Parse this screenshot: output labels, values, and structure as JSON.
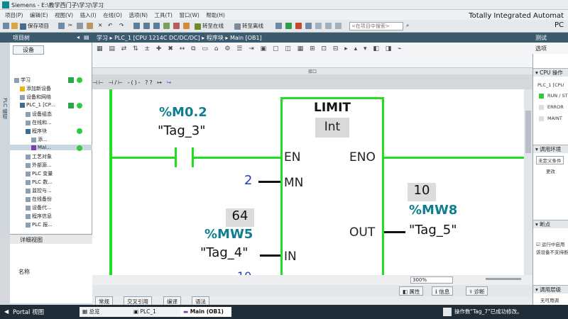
{
  "window": {
    "title": "Siemens - E:\\教学西门子\\学习\\学习",
    "brand_line1": "Totally Integrated Automat",
    "brand_line2": "PC"
  },
  "menu": [
    "项目(P)",
    "编辑(E)",
    "视图(V)",
    "插入(I)",
    "在线(O)",
    "选项(N)",
    "工具(T)",
    "窗口(W)",
    "帮助(H)"
  ],
  "toolbar": {
    "save_label": "保存项目",
    "go_online": "转至在线",
    "go_offline": "转至离线",
    "search_placeholder": "<在项目中搜索>"
  },
  "project_tree": {
    "header": "项目树",
    "tab": "设备",
    "side_label": "PLC 编程",
    "items": [
      {
        "label": "学习",
        "indent": 0
      },
      {
        "label": "添加新设备",
        "indent": 1
      },
      {
        "label": "设备和网络",
        "indent": 1
      },
      {
        "label": "PLC_1 [CP...",
        "indent": 1
      },
      {
        "label": "设备组态",
        "indent": 2
      },
      {
        "label": "在线和...",
        "indent": 2
      },
      {
        "label": "程序块",
        "indent": 2
      },
      {
        "label": "添...",
        "indent": 3
      },
      {
        "label": "Mai...",
        "indent": 3
      },
      {
        "label": "工艺对象",
        "indent": 2
      },
      {
        "label": "外部源...",
        "indent": 2
      },
      {
        "label": "PLC 变量",
        "indent": 2
      },
      {
        "label": "PLC 数...",
        "indent": 2
      },
      {
        "label": "监控与...",
        "indent": 2
      },
      {
        "label": "在线备份",
        "indent": 2
      },
      {
        "label": "设备代...",
        "indent": 2
      },
      {
        "label": "程序信息",
        "indent": 2
      },
      {
        "label": "PLC 报...",
        "indent": 2
      }
    ]
  },
  "detail_view": {
    "header": "详细视图",
    "column": "名称"
  },
  "breadcrumb": "学习 ▸ PLC_1 [CPU 1214C DC/DC/DC] ▸ 程序块 ▸ Main [OB1]",
  "editor": {
    "interface_label": "接口",
    "zoom": "300%",
    "block": {
      "name": "LIMIT",
      "type": "Int",
      "pin_en": "EN",
      "pin_eno": "ENO",
      "pin_mn": "MN",
      "pin_in": "IN",
      "pin_out": "OUT"
    },
    "contact": {
      "address": "%M0.2",
      "tag": "\"Tag_3\""
    },
    "mn_value": "2",
    "in_operand": {
      "monitor_value": "64",
      "address": "%MW5",
      "tag": "\"Tag_4\""
    },
    "out_operand": {
      "monitor_value": "10",
      "address": "%MW8",
      "tag": "\"Tag_5\""
    },
    "partial_value": "10"
  },
  "bottom_tabs": {
    "properties": "属性",
    "info": "信息",
    "diagnostics": "诊断",
    "sub": [
      "常规",
      "交叉引用",
      "编译",
      "语法"
    ]
  },
  "right_panel": {
    "header": "测试",
    "options": "选项",
    "cpu_section": "CPU 操作",
    "plc_label": "PLC_1 [CPU",
    "run_stop": "RUN / ST",
    "error": "ERROR",
    "maint": "MAINT",
    "call_env": "调用环境",
    "undefined_cond": "未定义条件",
    "change_btn": "更改",
    "breakpoints": "断点",
    "stop_at_bp": "运行中启用",
    "bp_note": "该设备不支持断",
    "call_hier": "调用层级",
    "no_call": "无可用调"
  },
  "taskbar": {
    "portal": "Portal 视图",
    "tasks": [
      "总览",
      "PLC_1",
      "Main (OB1)"
    ],
    "status": "操作数\"Tag_7\"已成功修改。"
  },
  "colors": {
    "power_flow": "#22dd22",
    "header_bar": "#3b5a6d",
    "block_border": "#22dd22"
  }
}
